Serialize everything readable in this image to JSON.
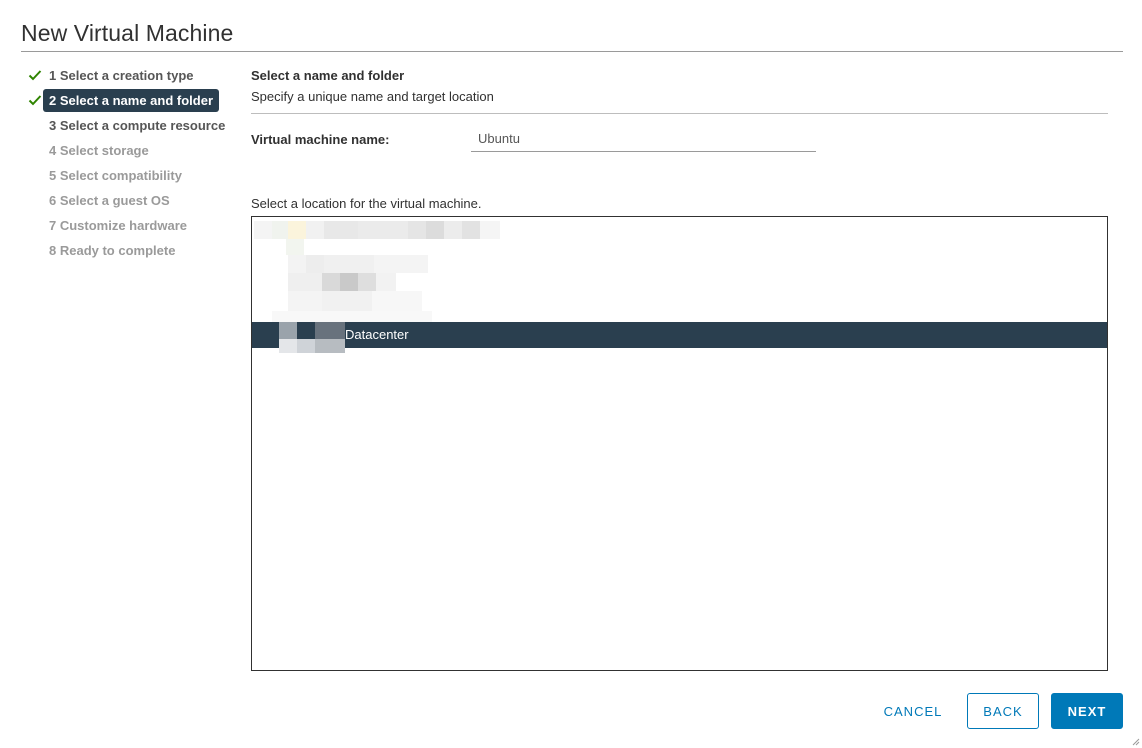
{
  "dialog": {
    "title": "New Virtual Machine"
  },
  "steps": [
    {
      "label": "1 Select a creation type",
      "state": "completed"
    },
    {
      "label": "2 Select a name and folder",
      "state": "active"
    },
    {
      "label": "3 Select a compute resource",
      "state": "enabled"
    },
    {
      "label": "4 Select storage",
      "state": "disabled"
    },
    {
      "label": "5 Select compatibility",
      "state": "disabled"
    },
    {
      "label": "6 Select a guest OS",
      "state": "disabled"
    },
    {
      "label": "7 Customize hardware",
      "state": "disabled"
    },
    {
      "label": "8 Ready to complete",
      "state": "disabled"
    }
  ],
  "main": {
    "section_title": "Select a name and folder",
    "section_subtitle": "Specify a unique name and target location",
    "vm_name_label": "Virtual machine name:",
    "vm_name_value": "Ubuntu",
    "location_label": "Select a location for the virtual machine.",
    "tree": {
      "selected_node": "Datacenter"
    }
  },
  "buttons": {
    "cancel": "CANCEL",
    "back": "BACK",
    "next": "NEXT"
  },
  "colors": {
    "accent": "#0079b8",
    "active_step_bg": "#2a3f4f",
    "check_green": "#2f8400"
  }
}
